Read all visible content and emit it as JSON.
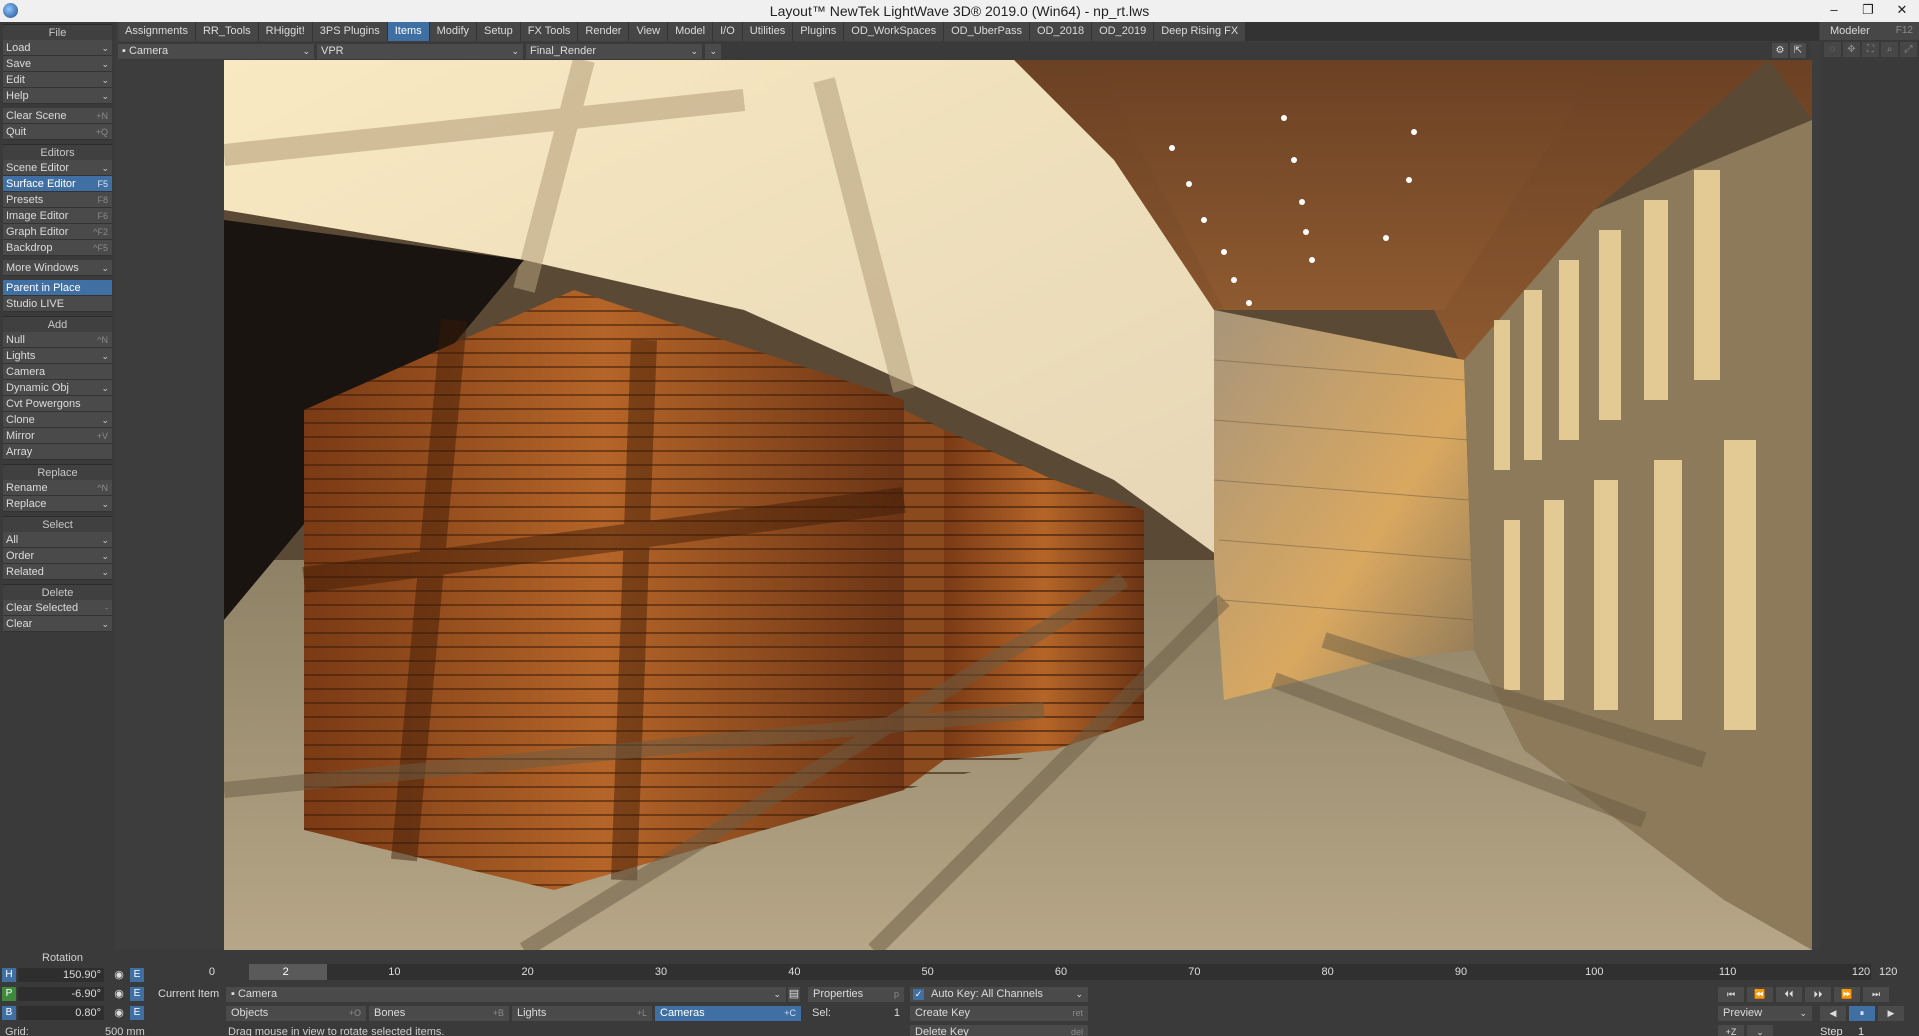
{
  "window": {
    "title": "Layout™ NewTek LightWave 3D® 2019.0 (Win64) - np_rt.lws",
    "minimize": "–",
    "restore": "❐",
    "close": "✕"
  },
  "sidebar": {
    "file_header": "File",
    "file_items": [
      {
        "label": "Load",
        "dd": "⌄"
      },
      {
        "label": "Save",
        "dd": "⌄"
      },
      {
        "label": "Edit",
        "dd": "⌄"
      },
      {
        "label": "Help",
        "dd": "⌄"
      }
    ],
    "file_actions": [
      {
        "label": "Clear Scene",
        "shortcut": "+N"
      },
      {
        "label": "Quit",
        "shortcut": "+Q"
      }
    ],
    "editors_header": "Editors",
    "editors_items": [
      {
        "label": "Scene Editor",
        "dd": "⌄",
        "shortcut": "",
        "active": false
      },
      {
        "label": "Surface Editor",
        "dd": "",
        "shortcut": "F5",
        "active": true
      },
      {
        "label": "Presets",
        "dd": "",
        "shortcut": "F8",
        "active": false
      },
      {
        "label": "Image Editor",
        "dd": "",
        "shortcut": "F6",
        "active": false
      },
      {
        "label": "Graph Editor",
        "dd": "",
        "shortcut": "^F2",
        "active": false
      },
      {
        "label": "Backdrop",
        "dd": "",
        "shortcut": "^F5",
        "active": false
      }
    ],
    "more_windows": "More Windows",
    "parent_in_place": "Parent in Place",
    "studio_live": "Studio LIVE",
    "add_header": "Add",
    "add_items": [
      {
        "label": "Null",
        "shortcut": "^N",
        "dd": ""
      },
      {
        "label": "Lights",
        "shortcut": "",
        "dd": "⌄"
      },
      {
        "label": "Camera",
        "shortcut": "",
        "dd": ""
      },
      {
        "label": "Dynamic Obj",
        "shortcut": "",
        "dd": "⌄"
      },
      {
        "label": "Cvt Powergons",
        "shortcut": "",
        "dd": ""
      },
      {
        "label": "Clone",
        "shortcut": "",
        "dd": "⌄"
      },
      {
        "label": "Mirror",
        "shortcut": "+V",
        "dd": ""
      },
      {
        "label": "Array",
        "shortcut": "",
        "dd": ""
      }
    ],
    "replace_header": "Replace",
    "replace_items": [
      {
        "label": "Rename",
        "shortcut": "^N",
        "dd": ""
      },
      {
        "label": "Replace",
        "shortcut": "",
        "dd": "⌄"
      }
    ],
    "select_header": "Select",
    "select_items": [
      {
        "label": "All",
        "dd": "⌄"
      },
      {
        "label": "Order",
        "dd": "⌄"
      },
      {
        "label": "Related",
        "dd": "⌄"
      }
    ],
    "delete_header": "Delete",
    "delete_items": [
      {
        "label": "Clear Selected",
        "shortcut": "-",
        "dd": ""
      },
      {
        "label": "Clear",
        "shortcut": "",
        "dd": "⌄"
      }
    ]
  },
  "tabs": [
    "Assignments",
    "RR_Tools",
    "RHiggit!",
    "3PS Plugins",
    "Items",
    "Modify",
    "Setup",
    "FX Tools",
    "Render",
    "View",
    "Model",
    "I/O",
    "Utilities",
    "Plugins",
    "OD_WorkSpaces",
    "OD_UberPass",
    "OD_2018",
    "OD_2019",
    "Deep Rising FX"
  ],
  "active_tab": "Items",
  "viewport": {
    "view_select": "Camera",
    "view_mode": "VPR",
    "render_mode": "Final_Render",
    "dd": "⌄",
    "gear": "⚙",
    "max": "⇱"
  },
  "right_panel": {
    "modeler": "Modeler",
    "modeler_shortcut": "F12",
    "icons": [
      "◌",
      "✥",
      "⛶",
      "⌕",
      "⤢"
    ]
  },
  "bottom": {
    "rotation_label": "Rotation",
    "h_axis": "H",
    "h_value": "150.90°",
    "p_axis": "P",
    "p_value": "-6.90°",
    "b_axis": "B",
    "b_value": "0.80°",
    "eye": "👁",
    "e_label": "E",
    "grid_label": "Grid:",
    "grid_value": "500 mm",
    "timeline_start": "0",
    "current_frame": "2",
    "timeline_ticks": [
      "10",
      "20",
      "30",
      "40",
      "50",
      "60",
      "70",
      "80",
      "90",
      "100",
      "110",
      "120"
    ],
    "timeline_end": "120",
    "current_item_label": "Current Item",
    "current_item_value": "Camera",
    "properties": "Properties",
    "properties_shortcut": "p",
    "auto_key": "Auto Key: All Channels",
    "objects": "Objects",
    "objects_sc": "+O",
    "bones": "Bones",
    "bones_sc": "+B",
    "lights": "Lights",
    "lights_sc": "+L",
    "cameras": "Cameras",
    "cameras_sc": "+C",
    "sel_label": "Sel:",
    "sel_value": "1",
    "create_key": "Create Key",
    "create_key_sc": "ret",
    "delete_key": "Delete Key",
    "delete_key_sc": "del",
    "status": "Drag mouse in view to rotate selected items.",
    "preview": "Preview",
    "step_label": "Step",
    "step_value": "1",
    "play_row1": [
      "⏮",
      "⏪",
      "⏴⏴",
      "⏵⏵",
      "⏩",
      "⏭"
    ],
    "play_row2": [
      "◀",
      "⏸",
      "▶"
    ],
    "play_row3": [
      "+Z",
      "⌄"
    ]
  },
  "colors": {
    "accent": "#3f6fa3",
    "panel": "#3a3a3a",
    "button": "#4a4a4a",
    "axis_h": "#3f6fa3",
    "axis_p": "#3d8a3d",
    "axis_b": "#3f6fa3"
  }
}
